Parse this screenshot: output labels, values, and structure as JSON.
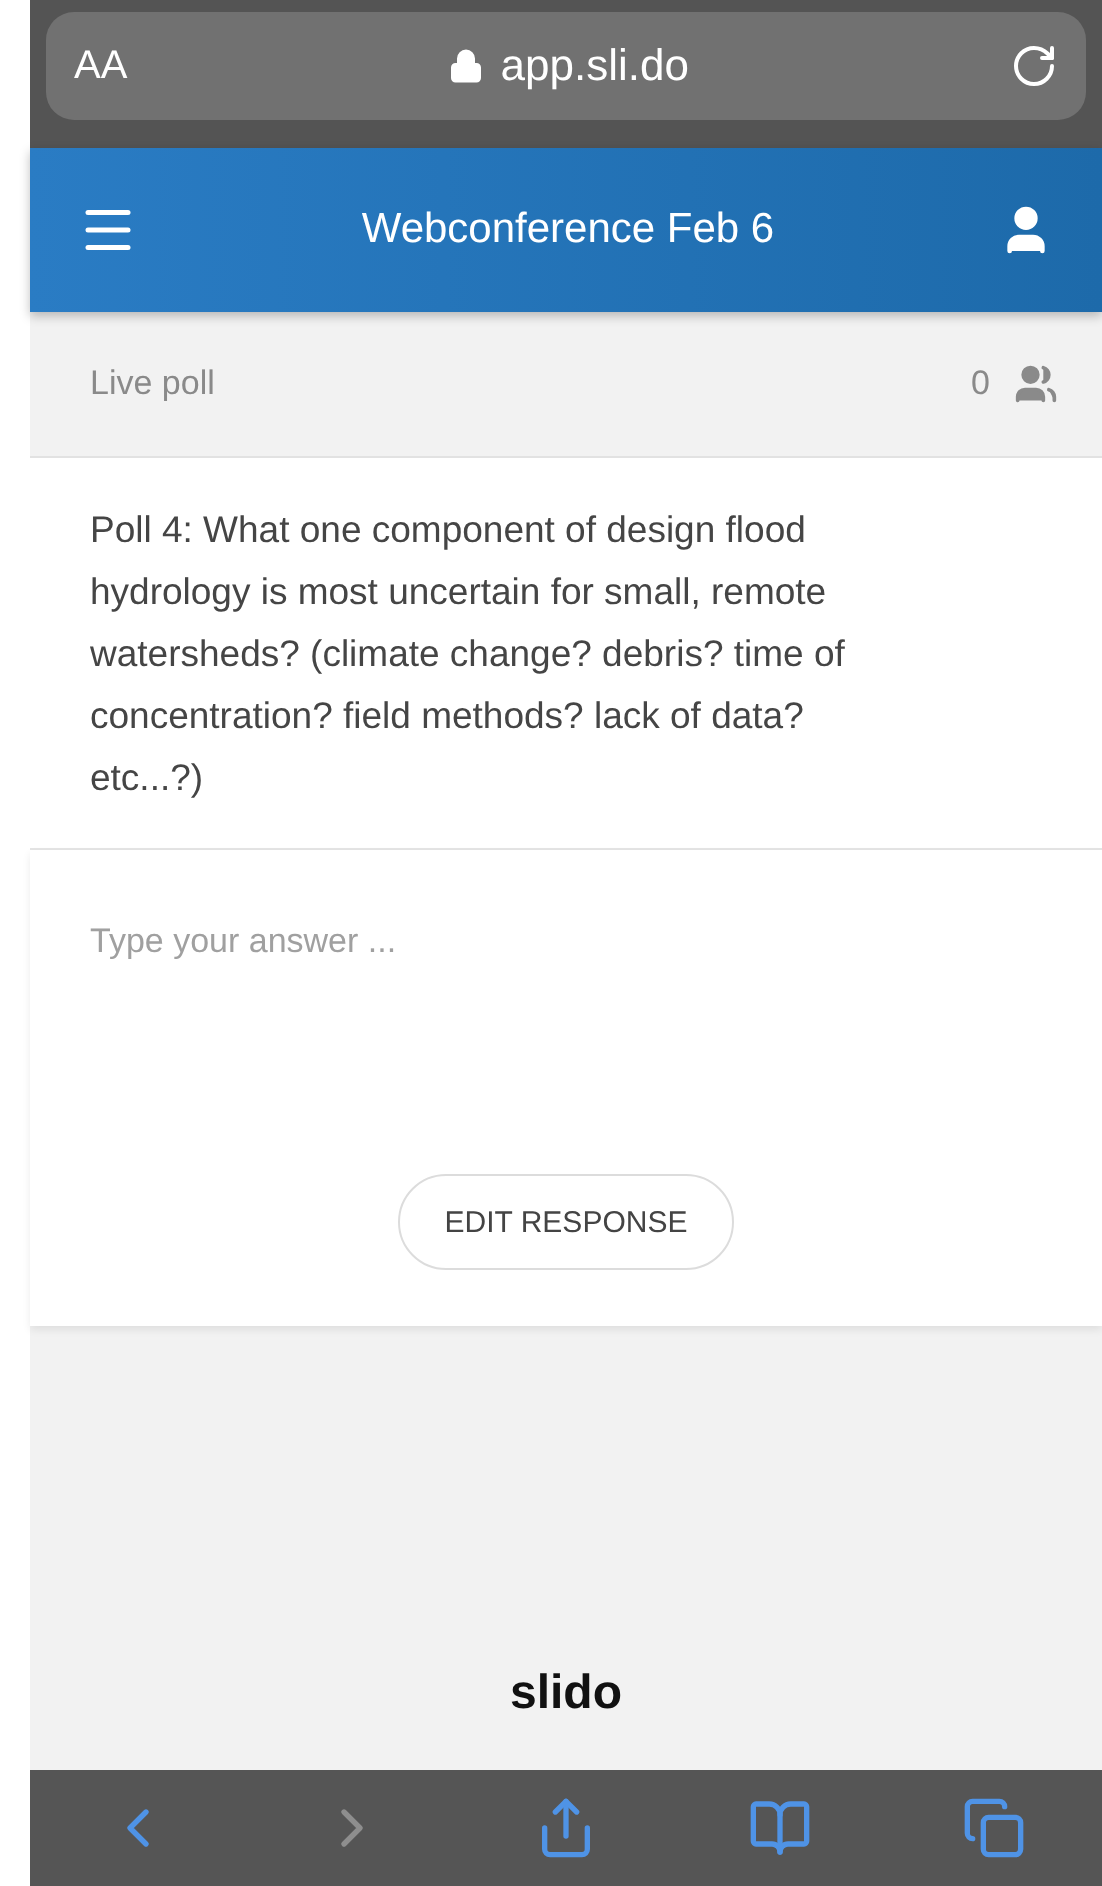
{
  "browser": {
    "text_size_label": "AA",
    "url": "app.sli.do"
  },
  "header": {
    "title": "Webconference Feb 6"
  },
  "poll_bar": {
    "label": "Live poll",
    "count": "0"
  },
  "question": {
    "text": "Poll 4: What one component of design flood hydrology is most uncertain for small, remote watersheds? (climate change? debris? time of concentration? field methods? lack of data? etc...?)"
  },
  "answer": {
    "placeholder": "Type your answer ...",
    "button": "EDIT RESPONSE"
  },
  "footer": {
    "logo": "slido"
  },
  "toolbar": [
    {
      "kind": "back",
      "disabled": false
    },
    {
      "kind": "forward",
      "disabled": true
    },
    {
      "kind": "share",
      "disabled": false
    },
    {
      "kind": "bookmarks",
      "disabled": false
    },
    {
      "kind": "tabs",
      "disabled": false
    }
  ]
}
